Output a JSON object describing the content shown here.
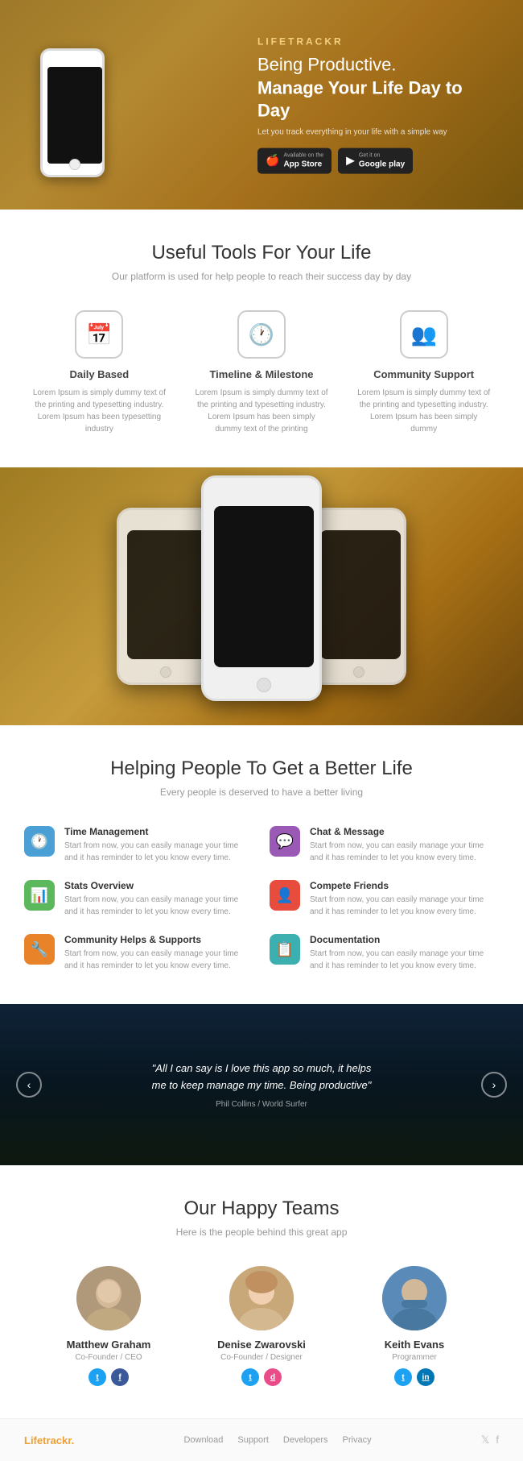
{
  "hero": {
    "brand": "LIFETRACKR",
    "tagline_line1": "Being Productive.",
    "tagline_line2": "Manage Your Life Day to Day",
    "subtitle": "Let you track everything in your life with a simple way",
    "appstore_label": "Available on the",
    "appstore_name": "App Store",
    "googleplay_label": "Get it on",
    "googleplay_name": "Google play"
  },
  "features": {
    "section_title": "Useful Tools For Your Life",
    "section_subtitle": "Our platform is used for help people to reach their success day by day",
    "items": [
      {
        "icon": "📅",
        "title": "Daily Based",
        "desc": "Lorem Ipsum is simply dummy text of the printing and typesetting industry. Lorem Ipsum has been typesetting industry"
      },
      {
        "icon": "🕐",
        "title": "Timeline & Milestone",
        "desc": "Lorem Ipsum is simply dummy text of the printing and typesetting industry. Lorem Ipsum has been simply dummy text of the printing"
      },
      {
        "icon": "👥",
        "title": "Community Support",
        "desc": "Lorem Ipsum is simply dummy text of the printing and typesetting industry. Lorem Ipsum has been simply dummy"
      }
    ]
  },
  "helping": {
    "section_title": "Helping People To Get a Better Life",
    "section_subtitle": "Every people is deserved to have a better living",
    "items": [
      {
        "icon": "🕐",
        "icon_class": "icon-blue",
        "title": "Time Management",
        "desc": "Start from now, you can easily manage your time and it has reminder to let you know every time."
      },
      {
        "icon": "💬",
        "icon_class": "icon-purple",
        "title": "Chat & Message",
        "desc": "Start from now, you can easily manage your time and it has reminder to let you know every time."
      },
      {
        "icon": "📊",
        "icon_class": "icon-green",
        "title": "Stats Overview",
        "desc": "Start from now, you can easily manage your time and it has reminder to let you know every time."
      },
      {
        "icon": "👤",
        "icon_class": "icon-red",
        "title": "Compete Friends",
        "desc": "Start from now, you can easily manage your time and it has reminder to let you know every time."
      },
      {
        "icon": "🔧",
        "icon_class": "icon-orange",
        "title": "Community Helps & Supports",
        "desc": "Start from now, you can easily manage your time and it has reminder to let you know every time."
      },
      {
        "icon": "📋",
        "icon_class": "icon-teal",
        "title": "Documentation",
        "desc": "Start from now, you can easily manage your time and it has reminder to let you know every time."
      }
    ]
  },
  "testimonial": {
    "quote": "\"All I can say is I love this app so much, it helps me to keep manage my time. Being productive\"",
    "author": "Phil Collins / World Surfer",
    "prev_label": "‹",
    "next_label": "›"
  },
  "team": {
    "section_title": "Our Happy Teams",
    "section_subtitle": "Here is the people behind this great app",
    "members": [
      {
        "name": "Matthew Graham",
        "role": "Co-Founder / CEO",
        "socials": [
          "twitter",
          "facebook"
        ]
      },
      {
        "name": "Denise Zwarovski",
        "role": "Co-Founder / Designer",
        "socials": [
          "twitter",
          "dribbble"
        ]
      },
      {
        "name": "Keith Evans",
        "role": "Programmer",
        "socials": [
          "twitter",
          "linkedin"
        ]
      }
    ]
  },
  "footer": {
    "brand": "Lifetrackr.",
    "nav": [
      "Download",
      "Support",
      "Developers",
      "Privacy"
    ],
    "social": [
      "twitter",
      "facebook"
    ]
  }
}
